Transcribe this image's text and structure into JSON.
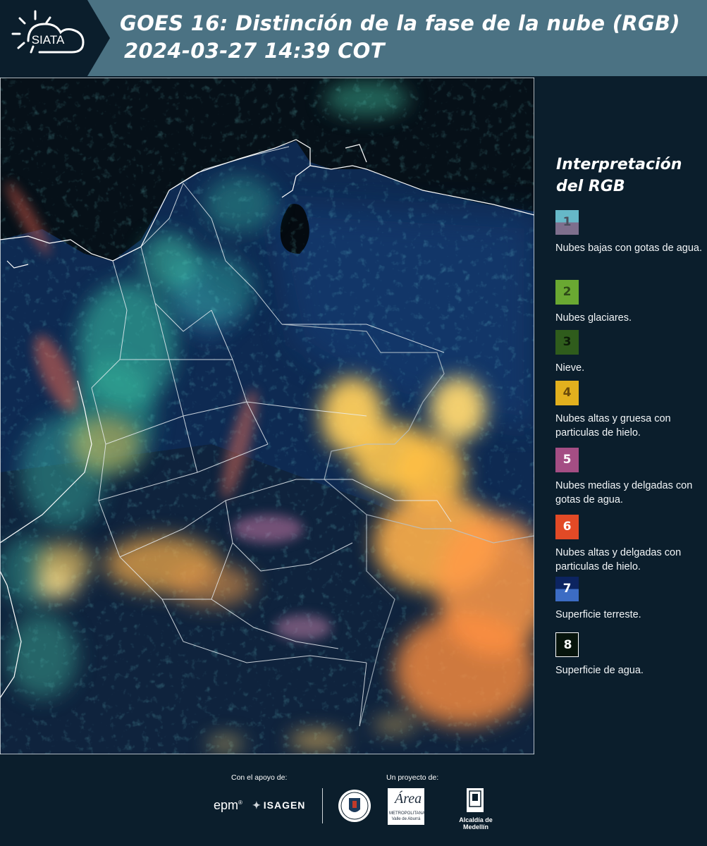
{
  "header": {
    "logo_text": "SIATA",
    "title_line1": "GOES 16: Distinción de la fase de la nube (RGB)",
    "title_line2": "2024-03-27 14:39 COT"
  },
  "legend": {
    "title": "Interpretación del RGB",
    "items": [
      {
        "number": "1",
        "label": "Nubes bajas con gotas de agua.",
        "color_top": "#66b8c8",
        "color_bottom": "#7e6f8d",
        "num_color": "#4b4f5e"
      },
      {
        "number": "2",
        "label": "Nubes glaciares.",
        "color_top": "#6aa832",
        "color_bottom": "#6aa832",
        "num_color": "#2e4a18"
      },
      {
        "number": "3",
        "label": "Nieve.",
        "color_top": "#2f5c1c",
        "color_bottom": "#2f5c1c",
        "num_color": "#0c1c08"
      },
      {
        "number": "4",
        "label": "Nubes altas y gruesa con particulas de hielo.",
        "color_top": "#e2b01e",
        "color_bottom": "#e2b01e",
        "num_color": "#6a4a0a"
      },
      {
        "number": "5",
        "label": "Nubes medias y delgadas con gotas de agua.",
        "color_top": "#a44e84",
        "color_bottom": "#a44e84",
        "num_color": "#ffffff"
      },
      {
        "number": "6",
        "label": "Nubes altas y delgadas con particulas de hielo.",
        "color_top": "#e24a26",
        "color_bottom": "#e24a26",
        "num_color": "#ffffff"
      },
      {
        "number": "7",
        "label": "Superficie terreste.",
        "color_top": "#0c2460",
        "color_bottom": "#3c6cc4",
        "num_color": "#ffffff"
      },
      {
        "number": "8",
        "label": "Superficie de agua.",
        "color_top": "#07140c",
        "color_bottom": "#07140c",
        "num_color": "#ffffff"
      }
    ]
  },
  "footer": {
    "support_label": "Con el apoyo de:",
    "project_label": "Un proyecto de:",
    "epm": "epm",
    "isagen": "ISAGEN",
    "area_name": "Área",
    "area_sub1": "METROPOLITANA",
    "area_sub2": "Valle de Aburrá",
    "alcaldia": "Alcaldía de Medellín"
  },
  "colors": {
    "header_bg": "#4b7283",
    "logo_bg": "#0b1e2c",
    "page_bg": "#0b1e2c"
  }
}
